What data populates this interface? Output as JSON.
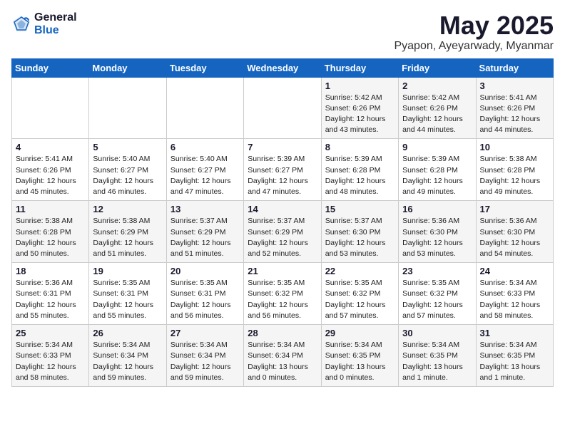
{
  "header": {
    "logo_general": "General",
    "logo_blue": "Blue",
    "title": "May 2025",
    "subtitle": "Pyapon, Ayeyarwady, Myanmar"
  },
  "days_of_week": [
    "Sunday",
    "Monday",
    "Tuesday",
    "Wednesday",
    "Thursday",
    "Friday",
    "Saturday"
  ],
  "weeks": [
    [
      {
        "day": "",
        "info": ""
      },
      {
        "day": "",
        "info": ""
      },
      {
        "day": "",
        "info": ""
      },
      {
        "day": "",
        "info": ""
      },
      {
        "day": "1",
        "info": "Sunrise: 5:42 AM\nSunset: 6:26 PM\nDaylight: 12 hours\nand 43 minutes."
      },
      {
        "day": "2",
        "info": "Sunrise: 5:42 AM\nSunset: 6:26 PM\nDaylight: 12 hours\nand 44 minutes."
      },
      {
        "day": "3",
        "info": "Sunrise: 5:41 AM\nSunset: 6:26 PM\nDaylight: 12 hours\nand 44 minutes."
      }
    ],
    [
      {
        "day": "4",
        "info": "Sunrise: 5:41 AM\nSunset: 6:26 PM\nDaylight: 12 hours\nand 45 minutes."
      },
      {
        "day": "5",
        "info": "Sunrise: 5:40 AM\nSunset: 6:27 PM\nDaylight: 12 hours\nand 46 minutes."
      },
      {
        "day": "6",
        "info": "Sunrise: 5:40 AM\nSunset: 6:27 PM\nDaylight: 12 hours\nand 47 minutes."
      },
      {
        "day": "7",
        "info": "Sunrise: 5:39 AM\nSunset: 6:27 PM\nDaylight: 12 hours\nand 47 minutes."
      },
      {
        "day": "8",
        "info": "Sunrise: 5:39 AM\nSunset: 6:28 PM\nDaylight: 12 hours\nand 48 minutes."
      },
      {
        "day": "9",
        "info": "Sunrise: 5:39 AM\nSunset: 6:28 PM\nDaylight: 12 hours\nand 49 minutes."
      },
      {
        "day": "10",
        "info": "Sunrise: 5:38 AM\nSunset: 6:28 PM\nDaylight: 12 hours\nand 49 minutes."
      }
    ],
    [
      {
        "day": "11",
        "info": "Sunrise: 5:38 AM\nSunset: 6:28 PM\nDaylight: 12 hours\nand 50 minutes."
      },
      {
        "day": "12",
        "info": "Sunrise: 5:38 AM\nSunset: 6:29 PM\nDaylight: 12 hours\nand 51 minutes."
      },
      {
        "day": "13",
        "info": "Sunrise: 5:37 AM\nSunset: 6:29 PM\nDaylight: 12 hours\nand 51 minutes."
      },
      {
        "day": "14",
        "info": "Sunrise: 5:37 AM\nSunset: 6:29 PM\nDaylight: 12 hours\nand 52 minutes."
      },
      {
        "day": "15",
        "info": "Sunrise: 5:37 AM\nSunset: 6:30 PM\nDaylight: 12 hours\nand 53 minutes."
      },
      {
        "day": "16",
        "info": "Sunrise: 5:36 AM\nSunset: 6:30 PM\nDaylight: 12 hours\nand 53 minutes."
      },
      {
        "day": "17",
        "info": "Sunrise: 5:36 AM\nSunset: 6:30 PM\nDaylight: 12 hours\nand 54 minutes."
      }
    ],
    [
      {
        "day": "18",
        "info": "Sunrise: 5:36 AM\nSunset: 6:31 PM\nDaylight: 12 hours\nand 55 minutes."
      },
      {
        "day": "19",
        "info": "Sunrise: 5:35 AM\nSunset: 6:31 PM\nDaylight: 12 hours\nand 55 minutes."
      },
      {
        "day": "20",
        "info": "Sunrise: 5:35 AM\nSunset: 6:31 PM\nDaylight: 12 hours\nand 56 minutes."
      },
      {
        "day": "21",
        "info": "Sunrise: 5:35 AM\nSunset: 6:32 PM\nDaylight: 12 hours\nand 56 minutes."
      },
      {
        "day": "22",
        "info": "Sunrise: 5:35 AM\nSunset: 6:32 PM\nDaylight: 12 hours\nand 57 minutes."
      },
      {
        "day": "23",
        "info": "Sunrise: 5:35 AM\nSunset: 6:32 PM\nDaylight: 12 hours\nand 57 minutes."
      },
      {
        "day": "24",
        "info": "Sunrise: 5:34 AM\nSunset: 6:33 PM\nDaylight: 12 hours\nand 58 minutes."
      }
    ],
    [
      {
        "day": "25",
        "info": "Sunrise: 5:34 AM\nSunset: 6:33 PM\nDaylight: 12 hours\nand 58 minutes."
      },
      {
        "day": "26",
        "info": "Sunrise: 5:34 AM\nSunset: 6:34 PM\nDaylight: 12 hours\nand 59 minutes."
      },
      {
        "day": "27",
        "info": "Sunrise: 5:34 AM\nSunset: 6:34 PM\nDaylight: 12 hours\nand 59 minutes."
      },
      {
        "day": "28",
        "info": "Sunrise: 5:34 AM\nSunset: 6:34 PM\nDaylight: 13 hours\nand 0 minutes."
      },
      {
        "day": "29",
        "info": "Sunrise: 5:34 AM\nSunset: 6:35 PM\nDaylight: 13 hours\nand 0 minutes."
      },
      {
        "day": "30",
        "info": "Sunrise: 5:34 AM\nSunset: 6:35 PM\nDaylight: 13 hours\nand 1 minute."
      },
      {
        "day": "31",
        "info": "Sunrise: 5:34 AM\nSunset: 6:35 PM\nDaylight: 13 hours\nand 1 minute."
      }
    ]
  ]
}
